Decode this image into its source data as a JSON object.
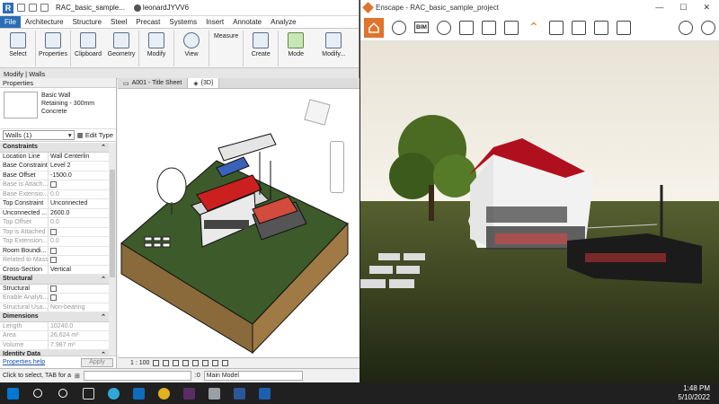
{
  "revit": {
    "doc_title": "RAC_basic_sample...",
    "user": "leonardJYVV6",
    "tabs": [
      "File",
      "Architecture",
      "Structure",
      "Steel",
      "Precast",
      "Systems",
      "Insert",
      "Annotate",
      "Analyze"
    ],
    "ribbon_tools": [
      {
        "label": "Select"
      },
      {
        "label": "Properties"
      },
      {
        "label": "Clipboard"
      },
      {
        "label": "Geometry"
      },
      {
        "label": "Modify"
      },
      {
        "label": "View"
      },
      {
        "label": "Measure"
      },
      {
        "label": "Create"
      },
      {
        "label": "Mode"
      },
      {
        "label": "Modify..."
      }
    ],
    "context_bar": "Modify | Walls",
    "properties": {
      "header": "Properties",
      "type_line1": "Basic Wall",
      "type_line2": "Retaining - 300mm",
      "type_line3": "Concrete",
      "filter": "Walls (1)",
      "edit_type": "Edit Type",
      "sections": [
        {
          "name": "Constraints",
          "rows": [
            {
              "k": "Location Line",
              "v": "Wall Centerlin",
              "dim": false
            },
            {
              "k": "Base Constraint",
              "v": "Level 2",
              "dim": false
            },
            {
              "k": "Base Offset",
              "v": "-1500.0",
              "dim": false
            },
            {
              "k": "Base is Attach...",
              "v": "",
              "chk": true,
              "dim": true
            },
            {
              "k": "Base Extensio...",
              "v": "0.0",
              "dim": true
            },
            {
              "k": "Top Constraint",
              "v": "Unconnected",
              "dim": false
            },
            {
              "k": "Unconnected ...",
              "v": "2600.0",
              "dim": false
            },
            {
              "k": "Top Offset",
              "v": "0.0",
              "dim": true
            },
            {
              "k": "Top is Attached",
              "v": "",
              "chk": true,
              "dim": true
            },
            {
              "k": "Top Extension...",
              "v": "0.0",
              "dim": true
            },
            {
              "k": "Room Boundi...",
              "v": "",
              "chk": true,
              "dim": false
            },
            {
              "k": "Related to Mass",
              "v": "",
              "chk": true,
              "dim": true
            },
            {
              "k": "Cross-Section",
              "v": "Vertical",
              "dim": false
            }
          ]
        },
        {
          "name": "Structural",
          "rows": [
            {
              "k": "Structural",
              "v": "",
              "chk": true,
              "dim": false
            },
            {
              "k": "Enable Analyti...",
              "v": "",
              "chk": true,
              "dim": true
            },
            {
              "k": "Structural Usa...",
              "v": "Non-bearing",
              "dim": true
            }
          ]
        },
        {
          "name": "Dimensions",
          "rows": [
            {
              "k": "Length",
              "v": "10240.0",
              "dim": true
            },
            {
              "k": "Area",
              "v": "26.624 m²",
              "dim": true
            },
            {
              "k": "Volume",
              "v": "7.987 m³",
              "dim": true
            }
          ]
        },
        {
          "name": "Identity Data",
          "rows": []
        }
      ],
      "help_link": "Properties help",
      "apply": "Apply"
    },
    "view_tabs": [
      {
        "label": "A001 - Title Sheet",
        "active": false
      },
      {
        "label": "{3D}",
        "active": true
      }
    ],
    "view_scale": "1 : 100",
    "status_text": "Click to select, TAB for a",
    "status_zero": ":0",
    "status_model": "Main Model"
  },
  "enscape": {
    "title": "Enscape - RAC_basic_sample_project",
    "toolbar_icons": [
      "home-icon",
      "pin-icon",
      "bim-icon",
      "binoculars-icon",
      "clapper-icon",
      "screenshot-icon",
      "panorama-icon",
      "export-icon",
      "batch-icon",
      "cube-icon",
      "material-icon",
      "up-icon",
      "visual-settings-icon",
      "settings-icon"
    ],
    "bim_label": "BIM",
    "accent": "#e0742c"
  },
  "taskbar": {
    "time": "1:48 PM",
    "date": "5/10/2022",
    "apps": [
      "windows-icon",
      "search-icon",
      "task-view-icon",
      "widgets-icon",
      "edge-icon",
      "mail-icon",
      "chrome-icon",
      "slack-icon",
      "drive-icon",
      "word-icon",
      "revit-icon"
    ]
  }
}
